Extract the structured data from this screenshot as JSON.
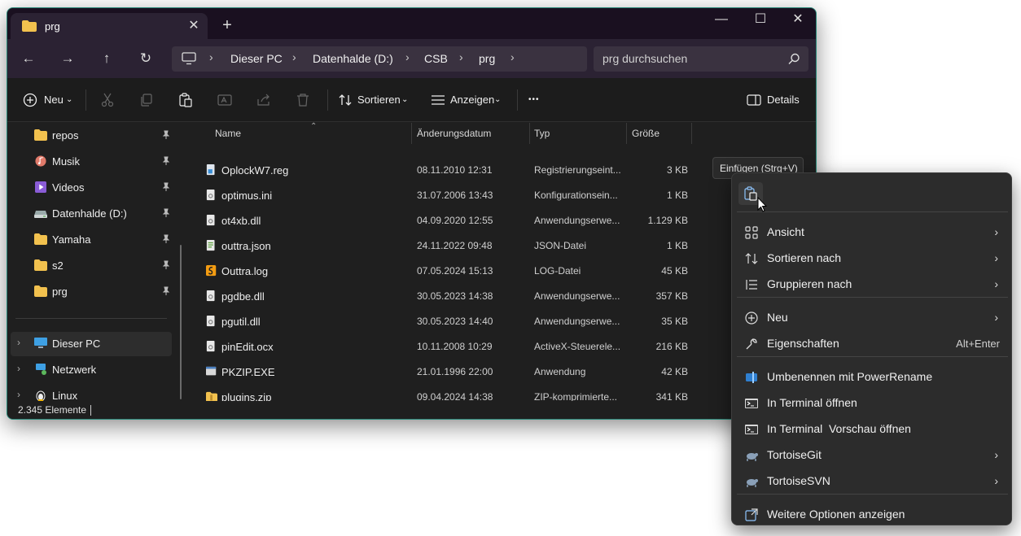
{
  "tab": {
    "title": "prg",
    "close": "✕",
    "new": "+"
  },
  "window_controls": {
    "minimize": "—",
    "maximize": "☐",
    "close": "✕"
  },
  "nav": {
    "back": "←",
    "forward": "→",
    "up": "↑",
    "refresh": "↻"
  },
  "breadcrumb": [
    "Dieser PC",
    "Datenhalde (D:)",
    "CSB",
    "prg"
  ],
  "search": {
    "placeholder": "prg durchsuchen"
  },
  "toolbar": {
    "new_label": "Neu",
    "sort_label": "Sortieren",
    "view_label": "Anzeigen",
    "more": "•••",
    "details_label": "Details"
  },
  "sidebar": {
    "items": [
      {
        "label": "repos",
        "icon": "folder-icon",
        "pinned": true
      },
      {
        "label": "Musik",
        "icon": "music-icon",
        "pinned": true
      },
      {
        "label": "Videos",
        "icon": "video-icon",
        "pinned": true
      },
      {
        "label": "Datenhalde (D:)",
        "icon": "drive-icon",
        "pinned": true
      },
      {
        "label": "Yamaha",
        "icon": "folder-icon",
        "pinned": true
      },
      {
        "label": "s2",
        "icon": "folder-icon",
        "pinned": true
      },
      {
        "label": "prg",
        "icon": "folder-icon",
        "pinned": true
      }
    ],
    "tree": [
      {
        "label": "Dieser PC",
        "icon": "pc-icon",
        "selected": true
      },
      {
        "label": "Netzwerk",
        "icon": "network-icon",
        "selected": false
      },
      {
        "label": "Linux",
        "icon": "linux-icon",
        "selected": false
      }
    ]
  },
  "columns": {
    "name": "Name",
    "date": "Änderungsdatum",
    "type": "Typ",
    "size": "Größe"
  },
  "files": [
    {
      "name": "OplockW7.reg",
      "date": "08.11.2010 12:31",
      "type": "Registrierungseint...",
      "size": "3 KB",
      "icon": "reg-icon"
    },
    {
      "name": "optimus.ini",
      "date": "31.07.2006 13:43",
      "type": "Konfigurationsein...",
      "size": "1 KB",
      "icon": "ini-icon"
    },
    {
      "name": "ot4xb.dll",
      "date": "04.09.2020 12:55",
      "type": "Anwendungserwe...",
      "size": "1.129 KB",
      "icon": "dll-icon"
    },
    {
      "name": "outtra.json",
      "date": "24.11.2022 09:48",
      "type": "JSON-Datei",
      "size": "1 KB",
      "icon": "json-icon"
    },
    {
      "name": "Outtra.log",
      "date": "07.05.2024 15:13",
      "type": "LOG-Datei",
      "size": "45 KB",
      "icon": "log-icon"
    },
    {
      "name": "pgdbe.dll",
      "date": "30.05.2023 14:38",
      "type": "Anwendungserwe...",
      "size": "357 KB",
      "icon": "dll-icon"
    },
    {
      "name": "pgutil.dll",
      "date": "30.05.2023 14:40",
      "type": "Anwendungserwe...",
      "size": "35 KB",
      "icon": "dll-icon"
    },
    {
      "name": "pinEdit.ocx",
      "date": "10.11.2008 10:29",
      "type": "ActiveX-Steuerele...",
      "size": "216 KB",
      "icon": "ocx-icon"
    },
    {
      "name": "PKZIP.EXE",
      "date": "21.01.1996 22:00",
      "type": "Anwendung",
      "size": "42 KB",
      "icon": "exe-icon"
    },
    {
      "name": "plugins.zip",
      "date": "09.04.2024 14:38",
      "type": "ZIP-komprimierte...",
      "size": "341 KB",
      "icon": "zip-icon"
    }
  ],
  "status": {
    "count": "2.345 Elemente"
  },
  "tooltip": {
    "text": "Einfügen (Strg+V)"
  },
  "context_menu": {
    "groups": [
      [
        {
          "label": "Ansicht",
          "icon": "grid-icon",
          "submenu": true
        },
        {
          "label": "Sortieren nach",
          "icon": "sort-icon",
          "submenu": true
        },
        {
          "label": "Gruppieren nach",
          "icon": "group-icon",
          "submenu": true
        }
      ],
      [
        {
          "label": "Neu",
          "icon": "plus-circle-icon",
          "submenu": true
        },
        {
          "label": "Eigenschaften",
          "icon": "wrench-icon",
          "submenu": false,
          "shortcut": "Alt+Enter"
        }
      ],
      [
        {
          "label": "Umbenennen mit PowerRename",
          "icon": "powerrename-icon",
          "submenu": false
        },
        {
          "label": "In Terminal öffnen",
          "icon": "terminal-icon",
          "submenu": false
        },
        {
          "label": "In Terminal  Vorschau öffnen",
          "icon": "terminal-preview-icon",
          "submenu": false
        },
        {
          "label": "TortoiseGit",
          "icon": "tortoise-icon",
          "submenu": true
        },
        {
          "label": "TortoiseSVN",
          "icon": "tortoise-icon",
          "submenu": true
        }
      ],
      [
        {
          "label": "Weitere Optionen anzeigen",
          "icon": "expand-icon",
          "submenu": false
        }
      ]
    ],
    "submenu_glyph": "›"
  },
  "colors": {
    "accent": "#2a8a7a",
    "folder": "#f2c14e",
    "window_bg": "#1f1f1f",
    "menu_bg": "#2c2c2c"
  }
}
